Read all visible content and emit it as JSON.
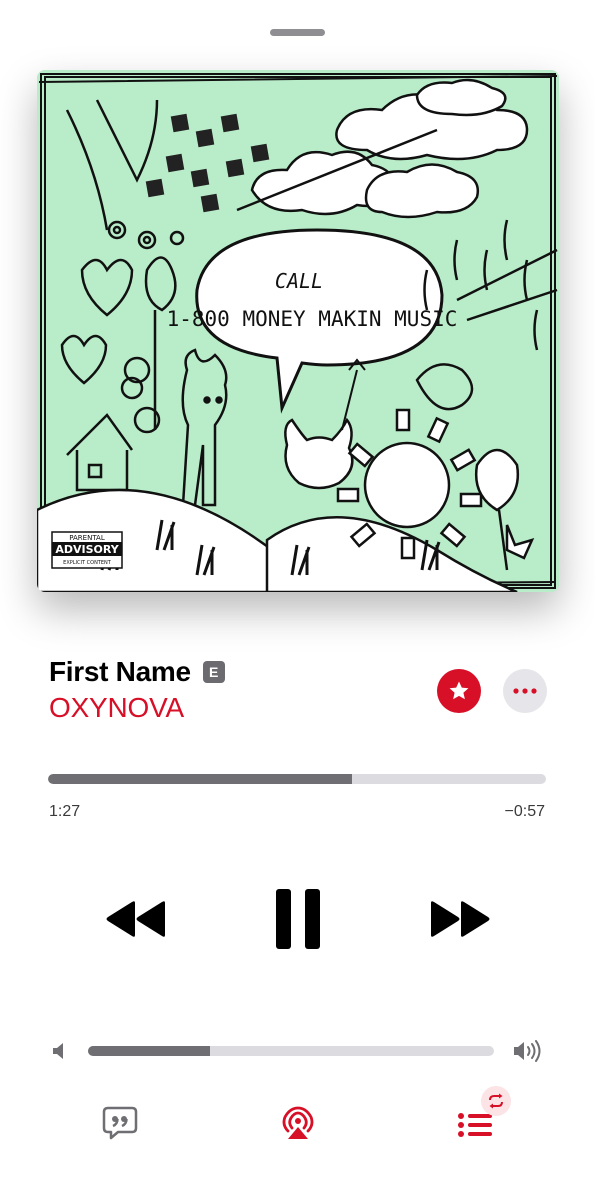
{
  "now_playing": {
    "title": "First Name",
    "explicit_badge": "E",
    "artist": "OXYNOVA",
    "progress": 0.61,
    "time_elapsed": "1:27",
    "time_remaining": "−0:57",
    "volume": 0.3
  },
  "artwork": {
    "bubble_line1": "CALL",
    "bubble_line2": "1-800 MONEY MAKIN MUSIC",
    "advisory_top": "PARENTAL",
    "advisory_main": "ADVISORY",
    "advisory_bottom": "EXPLICIT CONTENT",
    "background_color": "#b9ecc9"
  },
  "colors": {
    "accent": "#d70f27",
    "track_fill": "#6e6e73",
    "track_bg": "#dcdce0"
  },
  "icons": {
    "favorite": "star-icon",
    "more": "ellipsis-icon",
    "previous": "rewind-icon",
    "play_pause": "pause-icon",
    "next": "fast-forward-icon",
    "volume_low": "speaker-low-icon",
    "volume_high": "speaker-high-icon",
    "lyrics": "quote-bubble-icon",
    "airplay": "airplay-audio-icon",
    "queue": "queue-list-icon",
    "repeat": "repeat-icon"
  }
}
